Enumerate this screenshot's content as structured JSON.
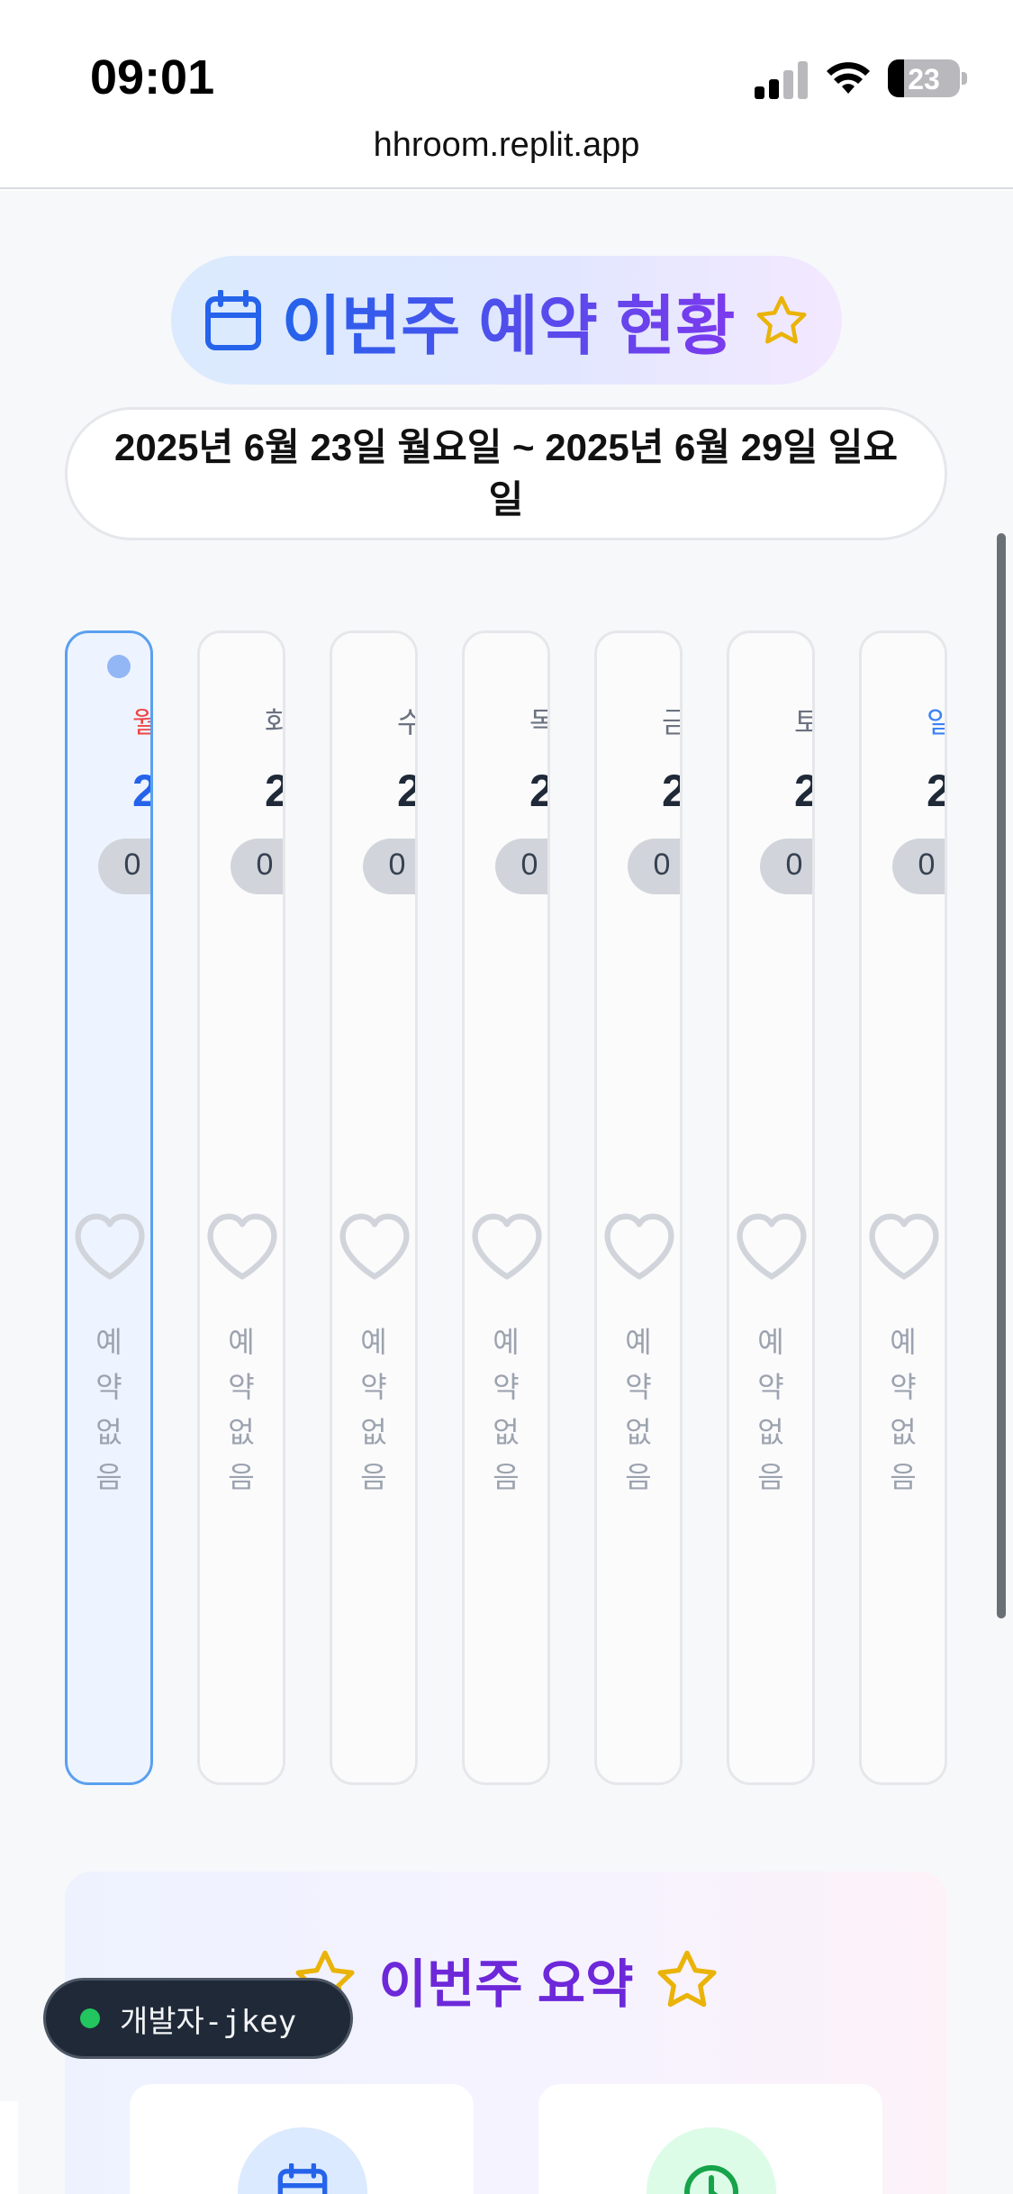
{
  "status_bar": {
    "time": "09:01",
    "battery": "23"
  },
  "browser": {
    "url": "hhroom.replit.app"
  },
  "header": {
    "title": "이번주 예약 현황",
    "date_range": "2025년 6월 23일 월요일 ~ 2025년 6월 29일 일요일"
  },
  "days": [
    {
      "label": "월",
      "num": "2",
      "count": "0",
      "empty": "예\n약\n없\n음",
      "label_color": "#ef4444",
      "num_color": "#2563eb"
    },
    {
      "label": "화",
      "num": "2",
      "count": "0",
      "empty": "예\n약\n없\n음"
    },
    {
      "label": "수",
      "num": "2",
      "count": "0",
      "empty": "예\n약\n없\n음"
    },
    {
      "label": "목",
      "num": "2",
      "count": "0",
      "empty": "예\n약\n없\n음"
    },
    {
      "label": "금",
      "num": "2",
      "count": "0",
      "empty": "예\n약\n없\n음"
    },
    {
      "label": "토",
      "num": "2",
      "count": "0",
      "empty": "예\n약\n없\n음"
    },
    {
      "label": "일",
      "num": "2",
      "count": "0",
      "empty": "예\n약\n없\n음",
      "label_color": "#3b82f6"
    }
  ],
  "summary": {
    "title": "이번주 요약"
  },
  "dev_badge": {
    "label": "개발자-jkey"
  },
  "colors": {
    "accent_blue": "#2563eb",
    "accent_purple": "#7c3aed",
    "star": "#eab308",
    "today_border": "#5aa0ef"
  }
}
